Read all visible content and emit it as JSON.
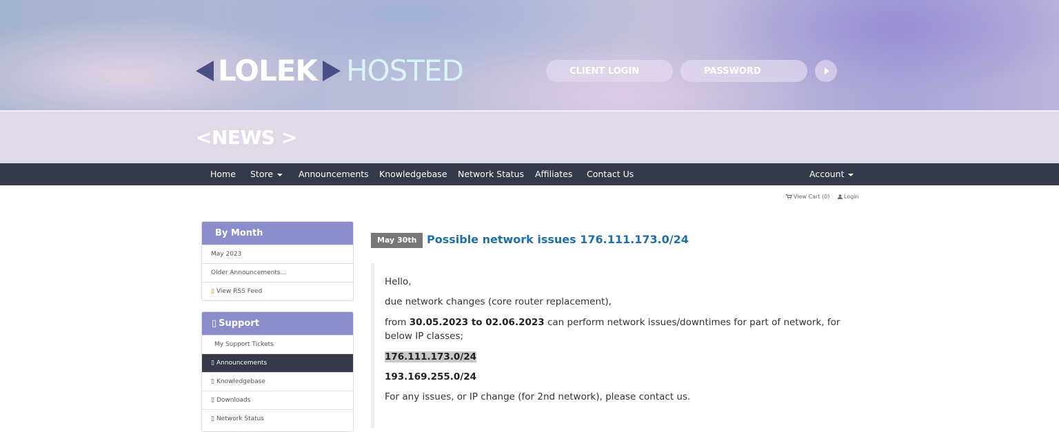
{
  "header": {
    "logo_main": "LOLEK",
    "logo_sub": "HOSTED",
    "client_login_placeholder": "CLIENT LOGIN",
    "password_placeholder": "PASSWORD"
  },
  "page": {
    "title": "<NEWS >"
  },
  "nav": {
    "items": [
      "Home",
      "Store",
      "Announcements",
      "Knowledgebase",
      "Network Status",
      "Affiliates",
      "Contact Us"
    ],
    "account": "Account"
  },
  "util": {
    "view_cart": "View Cart (0)",
    "login": "Login"
  },
  "sidebar": {
    "by_month": {
      "title": "By Month",
      "items": [
        "May 2023",
        "Older Announcements...",
        "View RSS Feed"
      ]
    },
    "support": {
      "title": "Support",
      "items": [
        "My Support Tickets",
        "Announcements",
        "Knowledgebase",
        "Downloads",
        "Network Status"
      ],
      "active_index": 1
    }
  },
  "post": {
    "date": "May 30th",
    "title": "Possible network issues 176.111.173.0/24",
    "greeting": "Hello,",
    "line1": "due network changes (core router replacement),",
    "line2_pre": "from ",
    "line2_bold": "30.05.2023 to 02.06.2023",
    "line2_post": " can perform network issues/downtimes for part of network, for below IP classes;",
    "ip1": "176.111.173.0/24",
    "ip2": "193.169.255.0/24",
    "closing": "For any issues, or IP change (for 2nd network), please contact us."
  }
}
